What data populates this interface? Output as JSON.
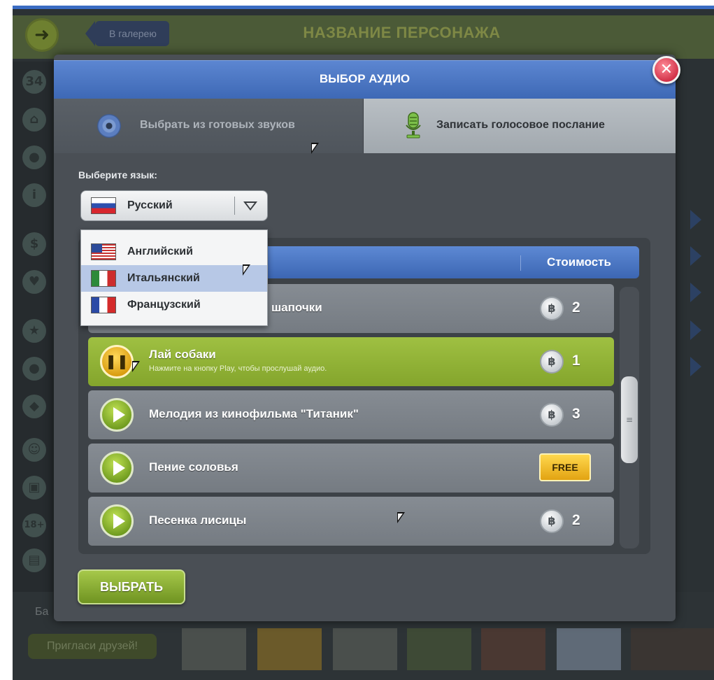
{
  "background": {
    "gallery_button": "В галерею",
    "page_title": "НАЗВАНИЕ ПЕРСОНАЖА",
    "sidebar_badge": "34",
    "age_label": "18+",
    "invite_button": "Пригласи друзей!",
    "bottom_label": "Ба"
  },
  "dialog": {
    "title": "ВЫБОР АУДИО",
    "tabs": [
      {
        "label": "Выбрать из готовых звуков",
        "icon": "disc-icon",
        "selected": true
      },
      {
        "label": "Записать голосовое послание",
        "icon": "microphone-icon",
        "selected": false
      }
    ],
    "language": {
      "label": "Выберите язык:",
      "selected": "Русский",
      "selected_flag": "flag-ru-icon",
      "options": [
        {
          "label": "Английский",
          "flag": "flag-us-icon"
        },
        {
          "label": "Итальянский",
          "flag": "flag-it-icon",
          "hovered": true
        },
        {
          "label": "Французский",
          "flag": "flag-fr-icon"
        }
      ]
    },
    "list": {
      "cost_header": "Стоимость",
      "items": [
        {
          "name": "шапочки",
          "cost": "2",
          "state": "play"
        },
        {
          "name": "Лай собаки",
          "hint": "Нажмите на кнопку Play, чтобы прослушай аудио.",
          "cost": "1",
          "state": "playing"
        },
        {
          "name": "Мелодия из кинофильма \"Титаник\"",
          "cost": "3",
          "state": "play"
        },
        {
          "name": "Пение соловья",
          "cost": "FREE",
          "state": "play"
        },
        {
          "name": "Песенка лисицы",
          "cost": "2",
          "state": "play"
        }
      ]
    },
    "choose_button": "ВЫБРАТЬ",
    "coin_symbol": "฿"
  },
  "colors": {
    "header_blue": "#4a74c0",
    "active_green": "#94b53a",
    "free_gold": "#f2c12c",
    "close_red": "#e04056"
  }
}
